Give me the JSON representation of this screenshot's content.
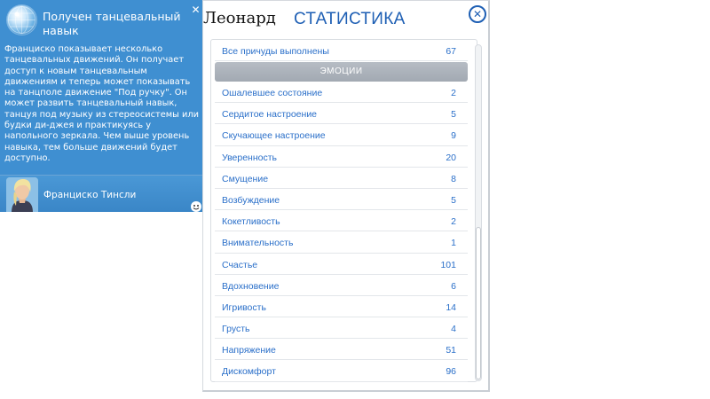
{
  "notification": {
    "title": "Получен танцевальный навык",
    "body": "Франциско показывает несколько танцевальных движений. Он получает доступ к новым танцевальным движениям и теперь может показывать на танцполе движение \"Под ручку\". Он может развить танцевальный навык, танцуя под музыку из стереосистемы или будки ди-джея и практикуясь у напольного зеркала. Чем выше уровень навыка, тем больше движений будет доступно.",
    "sim_name": "Франциско Тинсли",
    "close_label": "✕",
    "icon": "disco-ball-icon",
    "mood_icon": "happy-mood-icon",
    "colors": {
      "background": "#3f8fd1",
      "text": "#ffffff"
    }
  },
  "panel": {
    "sim_name": "Леонард",
    "title": "СТАТИСТИКА",
    "close_label": "✕",
    "colors": {
      "accent": "#1e5fb4",
      "row_text": "#2a6fc9",
      "category_bg": "#a9b0b8"
    },
    "first_row": {
      "label": "Все причуды выполнены",
      "value": "67"
    },
    "category": "ЭМОЦИИ",
    "rows": [
      {
        "label": "Ошалевшее состояние",
        "value": "2"
      },
      {
        "label": "Сердитое настроение",
        "value": "5"
      },
      {
        "label": "Скучающее настроение",
        "value": "9"
      },
      {
        "label": "Уверенность",
        "value": "20"
      },
      {
        "label": "Смущение",
        "value": "8"
      },
      {
        "label": "Возбуждение",
        "value": "5"
      },
      {
        "label": "Кокетливость",
        "value": "2"
      },
      {
        "label": "Внимательность",
        "value": "1"
      },
      {
        "label": "Счастье",
        "value": "101"
      },
      {
        "label": "Вдохновение",
        "value": "6"
      },
      {
        "label": "Игривость",
        "value": "14"
      },
      {
        "label": "Грусть",
        "value": "4"
      },
      {
        "label": "Напряжение",
        "value": "51"
      },
      {
        "label": "Дискомфорт",
        "value": "96"
      }
    ]
  }
}
